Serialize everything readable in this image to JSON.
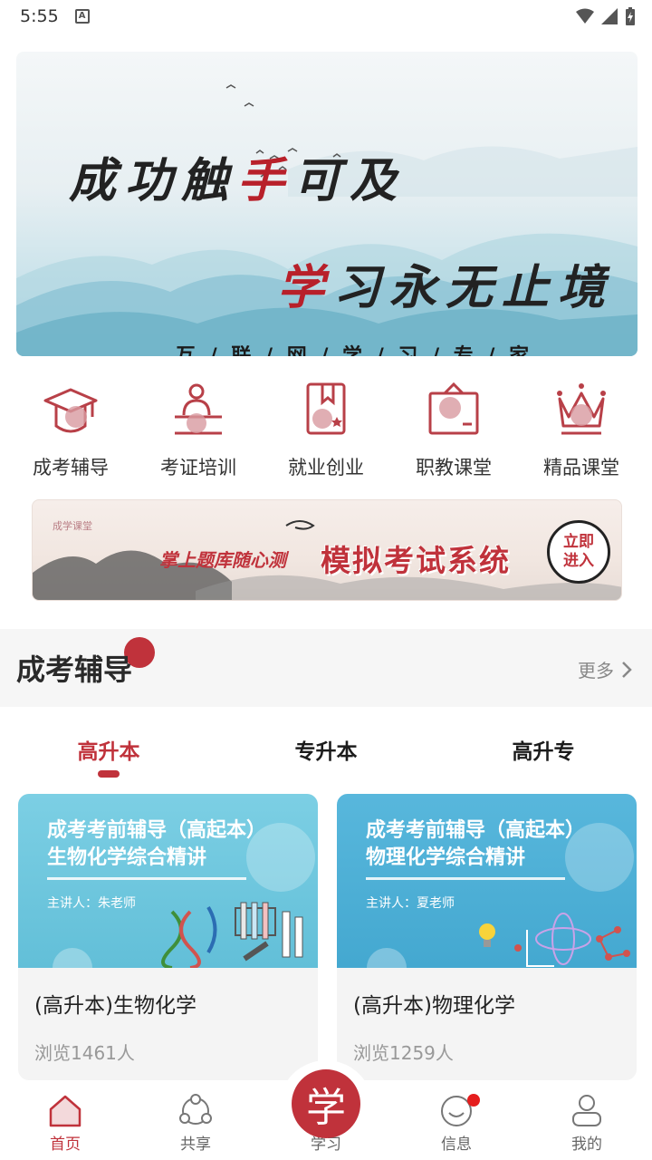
{
  "status": {
    "time": "5:55",
    "badge": "A"
  },
  "banner": {
    "line1_black": "成功触",
    "line1_red": "手",
    "line1_rest": "可及",
    "line2_red": "学",
    "line2_rest": "习永无止境",
    "tagline": "互 / 联 / 网 / 学 / 习 / 专 / 家"
  },
  "categories": [
    {
      "label": "成考辅导",
      "icon": "graduation-cap-icon"
    },
    {
      "label": "考证培训",
      "icon": "lecturer-podium-icon"
    },
    {
      "label": "就业创业",
      "icon": "book-bookmark-icon"
    },
    {
      "label": "职教课堂",
      "icon": "certificate-icon"
    },
    {
      "label": "精品课堂",
      "icon": "crown-icon"
    }
  ],
  "promo": {
    "brand": "成学课堂",
    "subtitle": "掌上题库随心测",
    "title": "模拟考试系统",
    "enter": "立即进入"
  },
  "section": {
    "title": "成考辅导",
    "more": "更多"
  },
  "tabs": [
    {
      "label": "高升本",
      "active": true
    },
    {
      "label": "专升本",
      "active": false
    },
    {
      "label": "高升专",
      "active": false
    }
  ],
  "cards": [
    {
      "thumb_line1": "成考考前辅导（高起本）",
      "thumb_line2": "生物化学综合精讲",
      "teacher": "主讲人：朱老师",
      "name": "(高升本)生物化学",
      "views": "浏览1461人",
      "color": "#6fc6dd"
    },
    {
      "thumb_line1": "成考考前辅导（高起本）",
      "thumb_line2": "物理化学综合精讲",
      "teacher": "主讲人：夏老师",
      "name": "(高升本)物理化学",
      "views": "浏览1259人",
      "color": "#4fb1d6"
    }
  ],
  "nav": [
    {
      "label": "首页",
      "icon": "home-icon",
      "active": true
    },
    {
      "label": "共享",
      "icon": "share-icon",
      "active": false
    },
    {
      "label": "学习",
      "icon": "study-icon",
      "active": false,
      "glyph": "学"
    },
    {
      "label": "信息",
      "icon": "message-icon",
      "active": false
    },
    {
      "label": "我的",
      "icon": "profile-icon",
      "active": false
    }
  ],
  "colors": {
    "accent": "#c0323b",
    "icon_fill": "#d89aa0"
  }
}
